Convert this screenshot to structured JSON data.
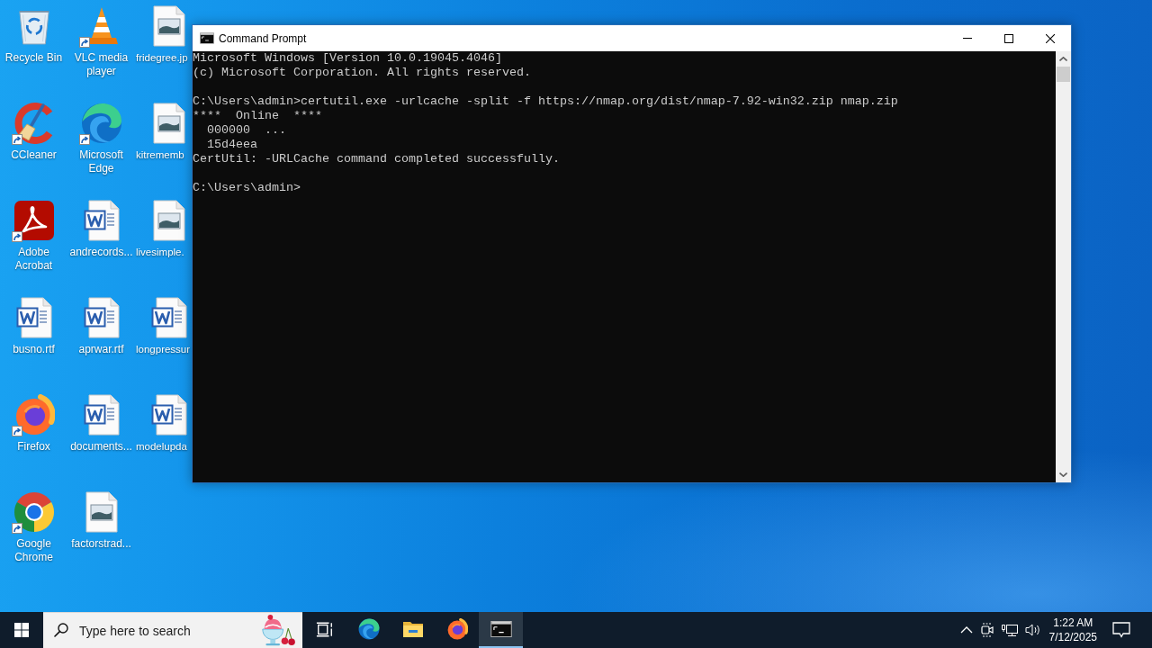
{
  "desktop_icons": [
    {
      "label": "Recycle Bin",
      "kind": "recyclebin",
      "shortcut": false
    },
    {
      "label": "CCleaner",
      "kind": "ccleaner",
      "shortcut": true
    },
    {
      "label": "Adobe Acrobat",
      "kind": "acrobat",
      "shortcut": true
    },
    {
      "label": "busno.rtf",
      "kind": "word",
      "shortcut": false
    },
    {
      "label": "Firefox",
      "kind": "firefox",
      "shortcut": true
    },
    {
      "label": "Google Chrome",
      "kind": "chrome",
      "shortcut": true
    },
    {
      "label": "VLC media player",
      "kind": "vlc",
      "shortcut": true
    },
    {
      "label": "Microsoft Edge",
      "kind": "edge",
      "shortcut": true
    },
    {
      "label": "andrecords...",
      "kind": "word",
      "shortcut": false
    },
    {
      "label": "aprwar.rtf",
      "kind": "word",
      "shortcut": false
    },
    {
      "label": "documents...",
      "kind": "word",
      "shortcut": false
    },
    {
      "label": "factorstrad...",
      "kind": "image",
      "shortcut": false
    },
    {
      "label": "fridegree.jp",
      "kind": "image",
      "shortcut": false
    },
    {
      "label": "kitrememb",
      "kind": "image",
      "shortcut": false
    },
    {
      "label": "livesimple.",
      "kind": "image",
      "shortcut": false
    },
    {
      "label": "longpressur",
      "kind": "word",
      "shortcut": false
    },
    {
      "label": "modelupda",
      "kind": "word",
      "shortcut": false
    }
  ],
  "window": {
    "title": "Command Prompt",
    "console": {
      "blocks": [
        [
          "Microsoft Windows [Version 10.0.19045.4046]",
          "(c) Microsoft Corporation. All rights reserved."
        ],
        [
          "C:\\Users\\admin>certutil.exe -urlcache -split -f https://nmap.org/dist/nmap-7.92-win32.zip nmap.zip",
          "****  Online  ****",
          "  000000  ...",
          "  15d4eea",
          "CertUtil: -URLCache command completed successfully."
        ],
        [
          "C:\\Users\\admin>"
        ]
      ]
    }
  },
  "taskbar": {
    "search": {
      "placeholder": "Type here to search"
    },
    "apps": [
      {
        "kind": "taskview",
        "selected": false
      },
      {
        "kind": "edge",
        "selected": false
      },
      {
        "kind": "explorer",
        "selected": false
      },
      {
        "kind": "firefox",
        "selected": false
      },
      {
        "kind": "terminal",
        "selected": true
      }
    ],
    "clock": {
      "time": "1:22 AM",
      "date": "7/12/2025"
    }
  }
}
